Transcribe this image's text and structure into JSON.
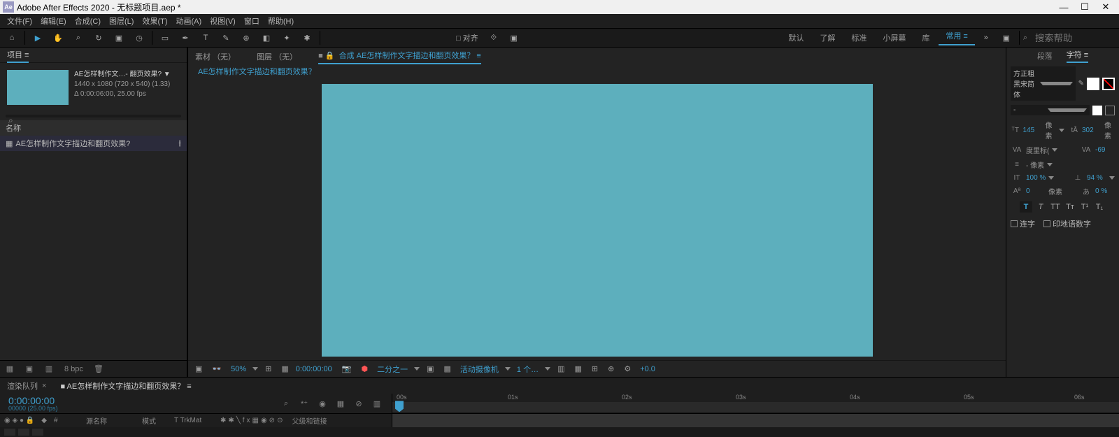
{
  "titlebar": {
    "icon": "Ae",
    "title": "Adobe After Effects 2020 - 无标题项目.aep *"
  },
  "menu": [
    "文件(F)",
    "编辑(E)",
    "合成(C)",
    "图层(L)",
    "效果(T)",
    "动画(A)",
    "视图(V)",
    "窗口",
    "帮助(H)"
  ],
  "toolbar": {
    "snap": "□ 对齐"
  },
  "workspaces": [
    "默认",
    "了解",
    "标准",
    "小屏幕",
    "库",
    "常用 ≡"
  ],
  "search_placeholder": "搜索帮助",
  "project": {
    "tab": "项目 ≡",
    "name": "AE怎样制作文…- 翻页效果? ▼",
    "dims": "1440 x 1080 (720 x 540) (1.33)",
    "dur": "Δ 0:00:06:00, 25.00 fps",
    "header": "名称",
    "item": "AE怎样制作文字描边和翻页效果?",
    "bpc": "8 bpc"
  },
  "viewer": {
    "tabs": {
      "source": "素材 （无）",
      "layer": "图层 （无）",
      "comp": "合成 AE怎样制作文字描边和翻页效果？ ≡"
    },
    "breadcrumb": "AE怎样制作文字描边和翻页效果？",
    "zoom": "50%",
    "time": "0:00:00:00",
    "res": "二分之一",
    "camera": "活动摄像机",
    "views": "1 个…",
    "exp": "+0.0"
  },
  "char_panel": {
    "tabs": [
      "段落",
      "字符 ≡"
    ],
    "font": "方正粗黑宋简体",
    "style": "-",
    "size": "145",
    "size_unit": "像素",
    "leading": "302",
    "leading_unit": "像素",
    "kerning": "度里标(",
    "tracking": "-69",
    "px": "- 像素",
    "vscale": "100 %",
    "hscale": "94 %",
    "baseline": "0",
    "baseline_unit": "像素",
    "tsume": "0 %",
    "tt_active": "T",
    "ligature": "连字",
    "hindi": "印地语数字"
  },
  "timeline": {
    "tabs": [
      "渲染队列",
      "AE怎样制作文字描边和翻页效果？ ≡"
    ],
    "time": "0:00:00:00",
    "sub": "00000 (25.00 fps)",
    "cols": {
      "num": "#",
      "src": "源名称",
      "mode": "模式",
      "trk": "T  TrkMat",
      "parent": "父级和链接"
    },
    "ticks": [
      "00s",
      "01s",
      "02s",
      "03s",
      "04s",
      "05s",
      "06s"
    ]
  }
}
